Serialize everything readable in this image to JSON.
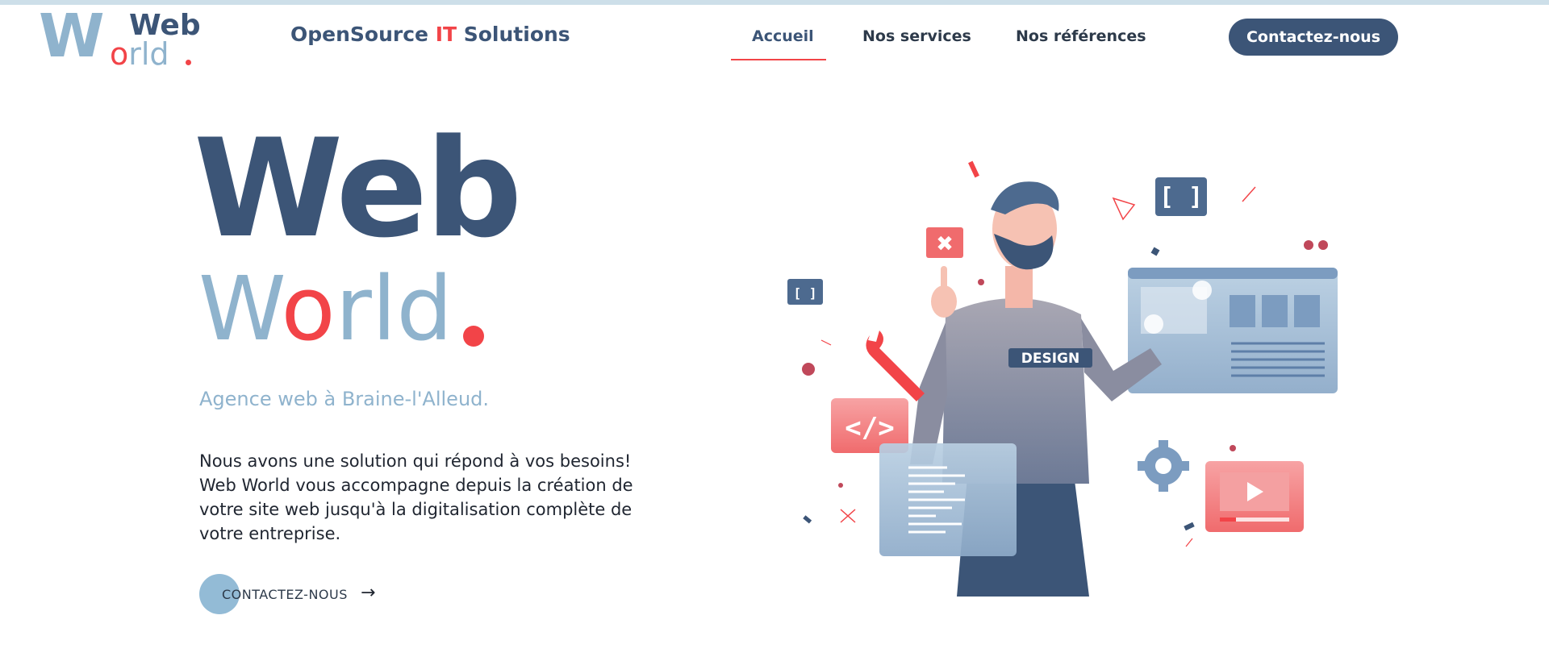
{
  "header": {
    "logo": {
      "w": "W",
      "web": "Web",
      "orld_o": "o",
      "orld_rest": "rld"
    },
    "tagline_part1": "OpenSource ",
    "tagline_it": "IT",
    "tagline_part2": " Solutions",
    "nav": [
      "Accueil",
      "Nos services",
      "Nos références"
    ],
    "active_nav": "Accueil",
    "contact_button": "Contactez-nous"
  },
  "hero": {
    "title_line1": "Web",
    "title_line2_w": "W",
    "title_line2_o": "o",
    "title_line2_rest": "rld",
    "subtitle": "Agence web à Braine-l'Alleud.",
    "description": "Nous avons une solution qui répond à vos besoins! Web World vous accompagne depuis la création de votre site web jusqu'à la digitalisation complète de votre entreprise.",
    "cta_label": "CONTACTEZ-NOUS",
    "cta_arrow": "→"
  },
  "illustration": {
    "shirt_text": "DESIGN",
    "code_tag": "</>",
    "brackets": "[ ]",
    "close_mark": "✖"
  },
  "colors": {
    "brand_dark": "#3c5577",
    "brand_light": "#8fb3cd",
    "accent_red": "#f24448",
    "topbar": "#cddfe9"
  }
}
